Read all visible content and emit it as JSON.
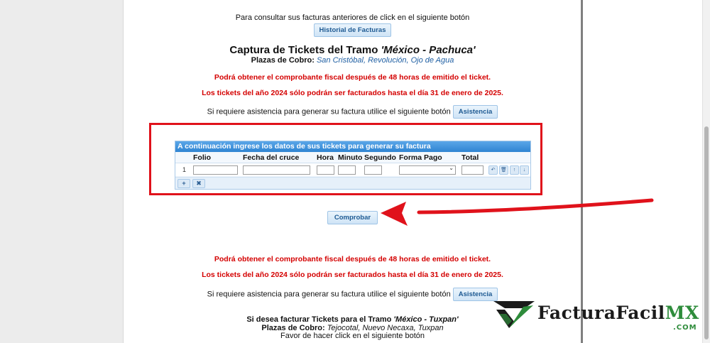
{
  "historial": {
    "prompt": "Para consultar sus facturas anteriores de click en el siguiente botón",
    "button_label": "Historial de Facturas"
  },
  "tramo1": {
    "title_prefix": "Captura de Tickets del Tramo ",
    "title_route": "'México - Pachuca'",
    "plazas_label": "Plazas de Cobro:",
    "plazas_values": "San Cristóbal, Revolución, Ojo de Agua",
    "notice_48h": "Podrá obtener el comprobante fiscal después de 48 horas de emitido el ticket.",
    "notice_2024": "Los tickets del año 2024 sólo podrán ser facturados hasta el día 31 de enero de 2025.",
    "asistencia_prompt": "Si requiere asistencia para generar su factura utilice el siguiente botón",
    "asistencia_button": "Asistencia"
  },
  "grid": {
    "caption": "A continuación ingrese los datos de sus tickets para generar su factura",
    "columns": [
      "Folio",
      "Fecha del cruce",
      "Hora",
      "Minuto",
      "Segundo",
      "Forma Pago",
      "Total"
    ],
    "row_number": "1",
    "actions": {
      "undo": "↶",
      "delete": "🗑",
      "up": "↑",
      "down": "↓"
    },
    "footer": {
      "add": "+",
      "remove": "✖"
    }
  },
  "comprobar_button": "Comprobar",
  "tramo1_repeat": {
    "notice_48h": "Podrá obtener el comprobante fiscal después de 48 horas de emitido el ticket.",
    "notice_2024": "Los tickets del año 2024 sólo podrán ser facturados hasta el día 31 de enero de 2025.",
    "asistencia_prompt": "Si requiere asistencia para generar su factura utilice el siguiente botón",
    "asistencia_button": "Asistencia"
  },
  "tramo2": {
    "title_prefix": "Si desea facturar Tickets para el Tramo ",
    "title_route": "'México - Tuxpan'",
    "plazas_label": "Plazas de Cobro:",
    "plazas_values": "Tejocotal, Nuevo Necaxa, Tuxpan",
    "click_prompt": "Favor de hacer click en el siguiente botón"
  },
  "logo": {
    "name": "FacturaFacil",
    "suffix": "MX",
    "domain": ".COM"
  },
  "colors": {
    "notice_red": "#d40000",
    "highlight_box": "#e0121b",
    "grid_header": "#2f84d2",
    "logo_green": "#2e8c3b"
  }
}
